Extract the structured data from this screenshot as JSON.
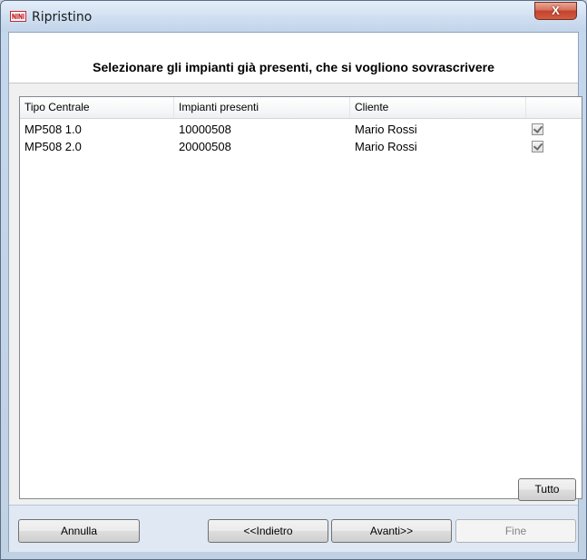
{
  "window": {
    "title": "Ripristino",
    "close_label": "X"
  },
  "header": {
    "instruction": "Selezionare gli impianti già presenti, che si vogliono sovrascrivere"
  },
  "table": {
    "columns": [
      "Tipo Centrale",
      "Impianti presenti",
      "Cliente",
      ""
    ],
    "rows": [
      {
        "tipo": "MP508 1.0",
        "impianti": "10000508",
        "cliente": "Mario Rossi",
        "checked": true
      },
      {
        "tipo": "MP508 2.0",
        "impianti": "20000508",
        "cliente": "Mario Rossi",
        "checked": true
      }
    ]
  },
  "buttons": {
    "tutto": "Tutto",
    "annulla": "Annulla",
    "indietro": "<<Indietro",
    "avanti": "Avanti>>",
    "fine": "Fine"
  },
  "colors": {
    "close": "#c4432e",
    "brand_icon": "#c4262e"
  }
}
